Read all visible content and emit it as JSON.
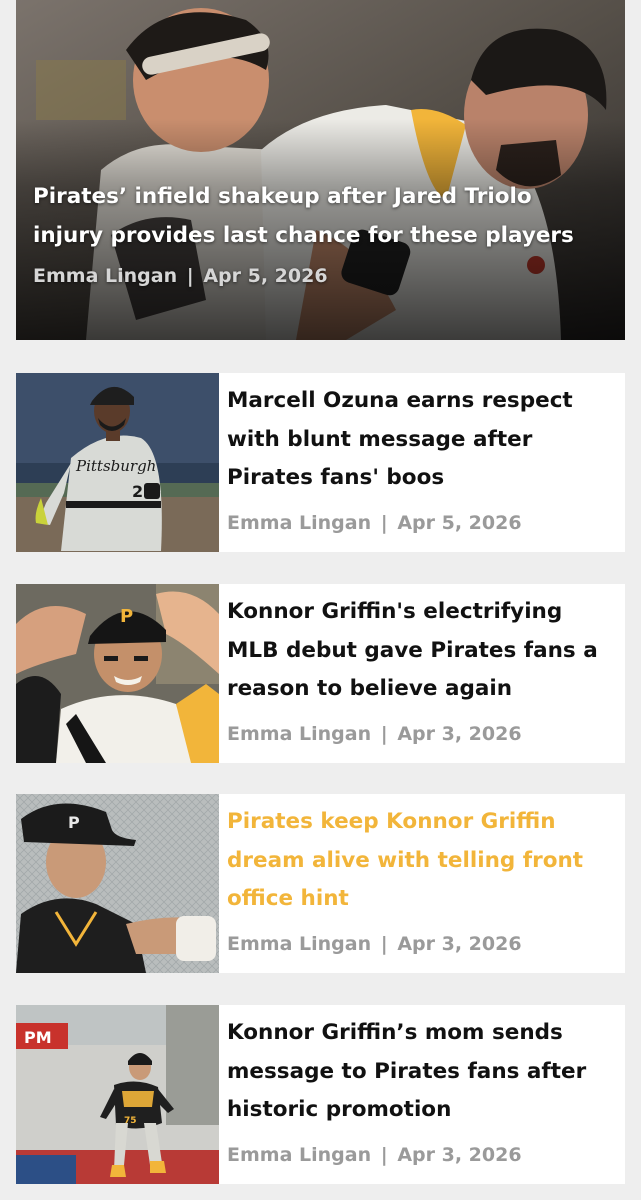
{
  "hero": {
    "title": "Pirates’ infield shakeup after Jared Triolo injury provides last chance for these players",
    "author": "Emma Lingan",
    "separator": "|",
    "date": "Apr 5, 2026"
  },
  "articles": [
    {
      "title": "Marcell Ozuna earns respect with blunt message after Pirates fans' boos",
      "author": "Emma Lingan",
      "separator": "|",
      "date": "Apr 5, 2026",
      "jersey_text": "Pittsburgh",
      "jersey_number": "2"
    },
    {
      "title": "Konnor Griffin's electrifying MLB debut gave Pirates fans a reason to believe again",
      "author": "Emma Lingan",
      "separator": "|",
      "date": "Apr 3, 2026",
      "cap_letter": "P"
    },
    {
      "title": "Pirates keep Konnor Griffin dream alive with telling front office hint",
      "author": "Emma Lingan",
      "separator": "|",
      "date": "Apr 3, 2026",
      "cap_letter": "P"
    },
    {
      "title": "Konnor Griffin’s mom sends message to Pirates fans after historic promotion",
      "author": "Emma Lingan",
      "separator": "|",
      "date": "Apr 3, 2026",
      "sign_text": "PM",
      "jersey_number": "75"
    }
  ],
  "colors": {
    "title_text": "#111111",
    "highlight_title": "#f2b53a",
    "meta_text": "#9a9a9a",
    "page_background": "#eeeeee",
    "card_background": "#ffffff",
    "pirates_gold": "#f2b53a",
    "pirates_black": "#1a1a1a"
  }
}
